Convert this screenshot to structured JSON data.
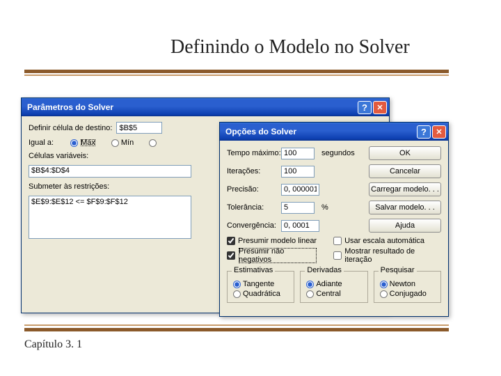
{
  "slide": {
    "title": "Definindo o Modelo no Solver",
    "footer": "Capítulo 3. 1"
  },
  "param_dialog": {
    "title": "Parâmetros do Solver",
    "target_label": "Definir célula de destino:",
    "target_value": "$B$5",
    "equal_label": "Igual a:",
    "radio_max": "Máx",
    "radio_min": "Mín",
    "var_cells_label": "Células variáveis:",
    "var_cells_value": "$B$4:$D$4",
    "constraints_label": "Submeter às restrições:",
    "constraint_entry": "$E$9:$E$12 <= $F$9:$F$12"
  },
  "opt_dialog": {
    "title": "Opções do Solver",
    "time_label": "Tempo máximo:",
    "time_value": "100",
    "time_unit": "segundos",
    "iter_label": "Iterações:",
    "iter_value": "100",
    "prec_label": "Precisão:",
    "prec_value": "0, 000001",
    "tol_label": "Tolerância:",
    "tol_value": "5",
    "tol_unit": "%",
    "conv_label": "Convergência:",
    "conv_value": "0, 0001",
    "chk_linear": "Presumir modelo linear",
    "chk_nonneg": "Presumir não negativos",
    "chk_autoscale": "Usar escala automática",
    "chk_showiter": "Mostrar resultado de iteração",
    "group_estimates": "Estimativas",
    "radio_tangent": "Tangente",
    "radio_quadratic": "Quadrática",
    "group_derivatives": "Derivadas",
    "radio_forward": "Adiante",
    "radio_central": "Central",
    "group_search": "Pesquisar",
    "radio_newton": "Newton",
    "radio_conjugate": "Conjugado",
    "btn_ok": "OK",
    "btn_cancel": "Cancelar",
    "btn_load": "Carregar modelo. . .",
    "btn_save": "Salvar modelo. . .",
    "btn_help": "Ajuda"
  }
}
